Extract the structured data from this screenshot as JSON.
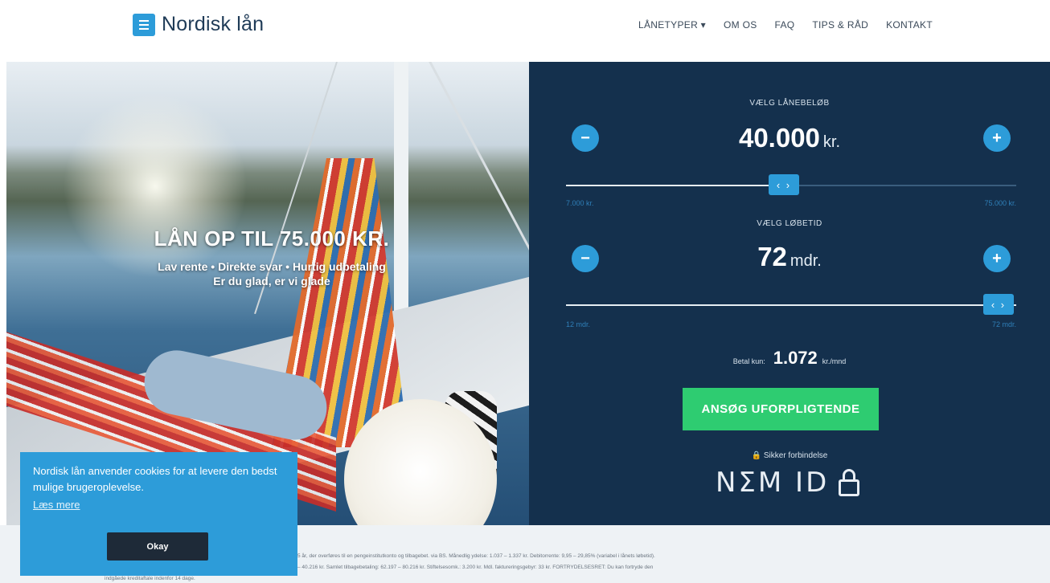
{
  "header": {
    "logo_text": "Nordisk lån",
    "nav": [
      {
        "label": "LÅNETYPER ▾"
      },
      {
        "label": "OM OS"
      },
      {
        "label": "FAQ"
      },
      {
        "label": "TIPS & RÅD"
      },
      {
        "label": "KONTAKT"
      }
    ]
  },
  "hero": {
    "title": "LÅN OP TIL 75.000 KR.",
    "subtitle": "Lav rente • Direkte svar • Hurtig udbetaling",
    "tagline": "Er du glad, er vi glade"
  },
  "calculator": {
    "amount": {
      "label": "VÆLG LÅNEBELØB",
      "value": "40.000",
      "unit": "kr.",
      "min": "7.000 kr.",
      "max": "75.000 kr.",
      "position": 0.49
    },
    "term": {
      "label": "VÆLG LØBETID",
      "value": "72",
      "unit": "mdr.",
      "min": "12 mdr.",
      "max": "72 mdr.",
      "position": 1.0
    },
    "payment": {
      "prefix": "Betal kun:",
      "value": "1.072",
      "unit": "kr./mnd"
    },
    "minus_symbol": "−",
    "plus_symbol": "+",
    "handle_symbol": "‹ ›",
    "apply_label": "ANSØG UFORPLIGTENDE",
    "secure_label": "🔒 Sikker forbindelse",
    "nemid_label": "NΣM ID"
  },
  "footer": {
    "disclaimer_line1": "5 år, der overføres til en pengeinstitutkonto og tilbagebet. via BS. Månedlig ydelse: 1.037 – 1.337 kr. Debitorrente: 9,95 – 29,85% (variabel i lånets løbetid).",
    "disclaimer_line2": "– 40.216 kr. Samlet tilbagebetaling: 62.197 – 80.216 kr. Stiftelsesomk.: 3.200 kr. Mdl. faktureringsgebyr: 33 kr. FORTRYDELSESRET: Du kan fortryde den",
    "disclaimer_line3": "indgåede kreditaftale indenfor 14 dage."
  },
  "cookie": {
    "text": "Nordisk lån anvender cookies for at levere den bedst mulige brugeroplevelse.",
    "link": "Læs mere",
    "button": "Okay"
  },
  "colors": {
    "brand_blue": "#2d9cd9",
    "navy": "#14304d",
    "cta_green": "#2ecc71"
  }
}
